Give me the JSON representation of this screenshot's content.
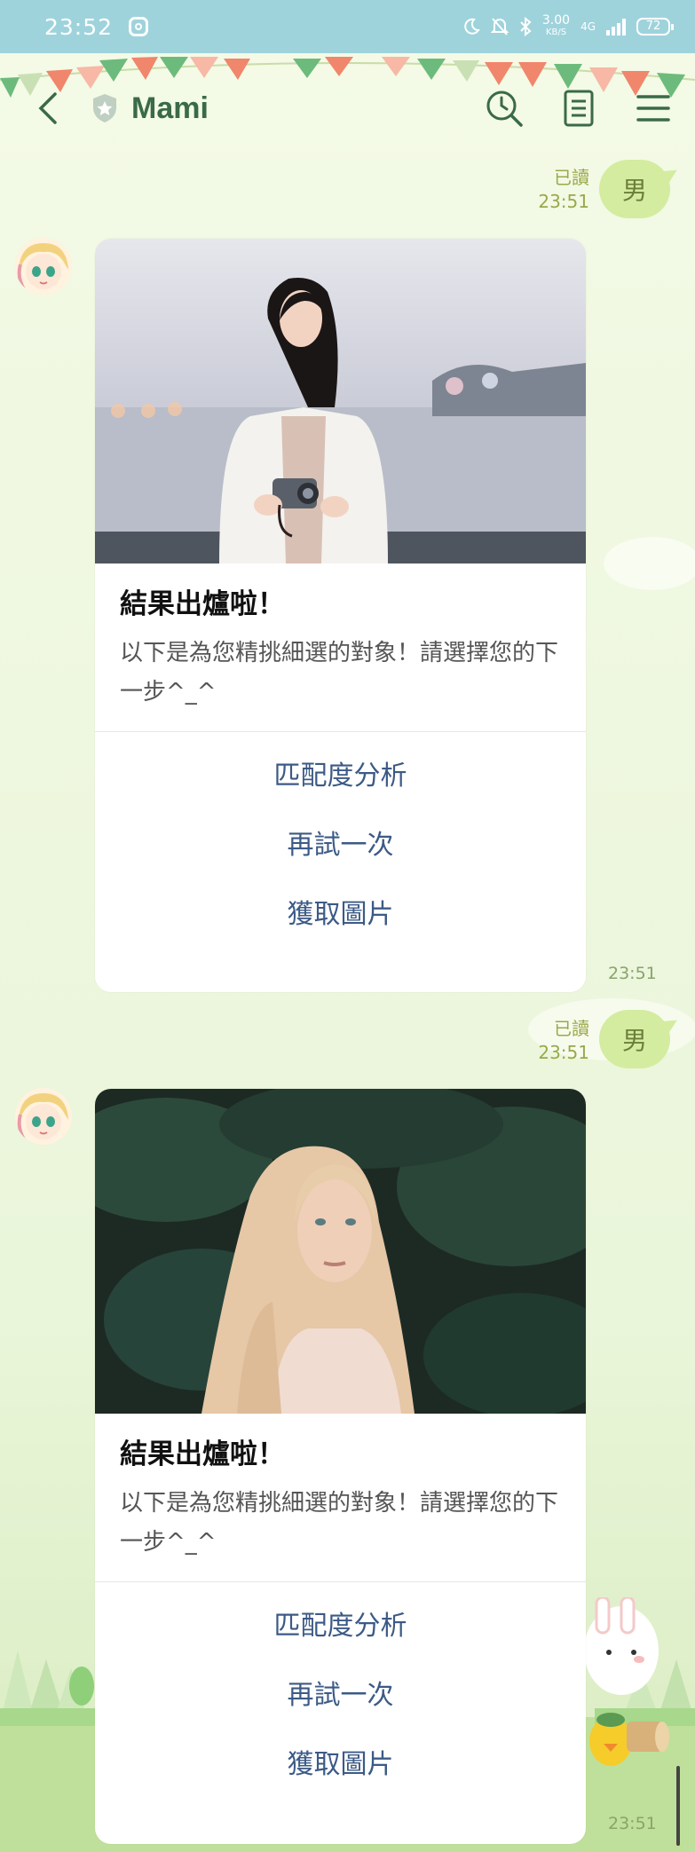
{
  "status_bar": {
    "time": "23:52",
    "speed_value": "3.00",
    "speed_unit": "KB/S",
    "network": "4G",
    "battery": "72"
  },
  "header": {
    "title": "Mami"
  },
  "messages": [
    {
      "read_label": "已讀",
      "time": "23:51",
      "text": "男"
    },
    {
      "title": "結果出爐啦！",
      "description": "以下是為您精挑細選的對象！請選擇您的下一步^_^",
      "actions": [
        "匹配度分析",
        "再試一次",
        "獲取圖片"
      ],
      "time": "23:51"
    },
    {
      "read_label": "已讀",
      "time": "23:51",
      "text": "男"
    },
    {
      "title": "結果出爐啦！",
      "description": "以下是為您精挑細選的對象！請選擇您的下一步^_^",
      "actions": [
        "匹配度分析",
        "再試一次",
        "獲取圖片"
      ],
      "time": "23:51"
    }
  ],
  "colors": {
    "status_bar": "#9fd3dc",
    "title": "#3a6a48",
    "bubble": "#d4ec9f",
    "action_link": "#3c5a86"
  },
  "icons": [
    "back-arrow-icon",
    "shield-icon",
    "search-clock-icon",
    "notes-icon",
    "menu-icon"
  ]
}
